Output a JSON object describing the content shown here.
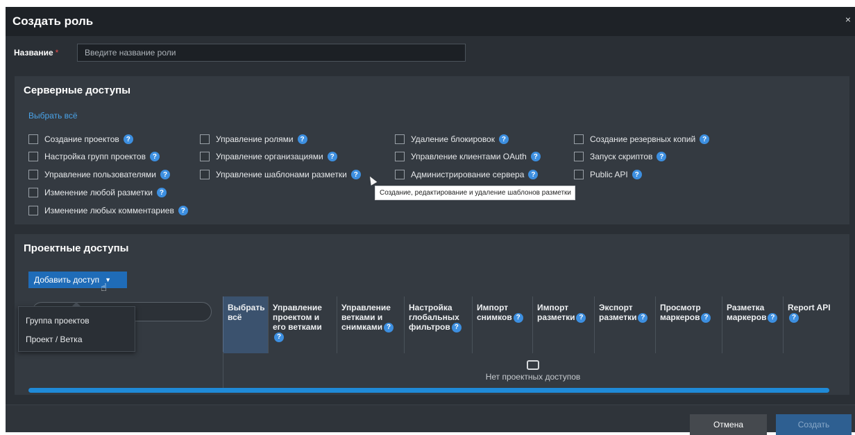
{
  "dialog": {
    "title": "Создать роль",
    "close_icon": "×"
  },
  "name_field": {
    "label": "Название",
    "required_mark": "*",
    "placeholder": "Введите название роли"
  },
  "server_access": {
    "title": "Серверные доступы",
    "select_all": "Выбрать всё",
    "columns": [
      [
        "Создание проектов",
        "Настройка групп проектов",
        "Управление пользователями",
        "Изменение любой разметки",
        "Изменение любых комментариев"
      ],
      [
        "Управление ролями",
        "Управление организациями",
        "Управление шаблонами разметки"
      ],
      [
        "Удаление блокировок",
        "Управление клиентами OAuth",
        "Администрирование сервера"
      ],
      [
        "Создание резервных копий",
        "Запуск скриптов",
        "Public API"
      ]
    ],
    "tooltip": "Создание, редактирование и удаление шаблонов разметки"
  },
  "project_access": {
    "title": "Проектные доступы",
    "add_button": "Добавить доступ",
    "dropdown": [
      "Группа проектов",
      "Проект / Ветка"
    ],
    "columns": [
      {
        "label": "Выбрать всё",
        "help": false
      },
      {
        "label": "Управление проектом и его ветками",
        "help": true
      },
      {
        "label": "Управление ветками и снимками",
        "help": true
      },
      {
        "label": "Настройка глобальных фильтров",
        "help": true
      },
      {
        "label": "Импорт снимков",
        "help": true
      },
      {
        "label": "Импорт разметки",
        "help": true
      },
      {
        "label": "Экспорт разметки",
        "help": true
      },
      {
        "label": "Просмотр маркеров",
        "help": true
      },
      {
        "label": "Разметка маркеров",
        "help": true
      },
      {
        "label": "Report API",
        "help": true
      }
    ],
    "empty_text": "Нет проектных доступов"
  },
  "footer": {
    "cancel": "Отмена",
    "create": "Создать"
  },
  "colors": {
    "accent": "#1f6cb8",
    "link": "#4aa3e8",
    "help_icon": "#3d8fe0",
    "required": "#e84a4a"
  }
}
